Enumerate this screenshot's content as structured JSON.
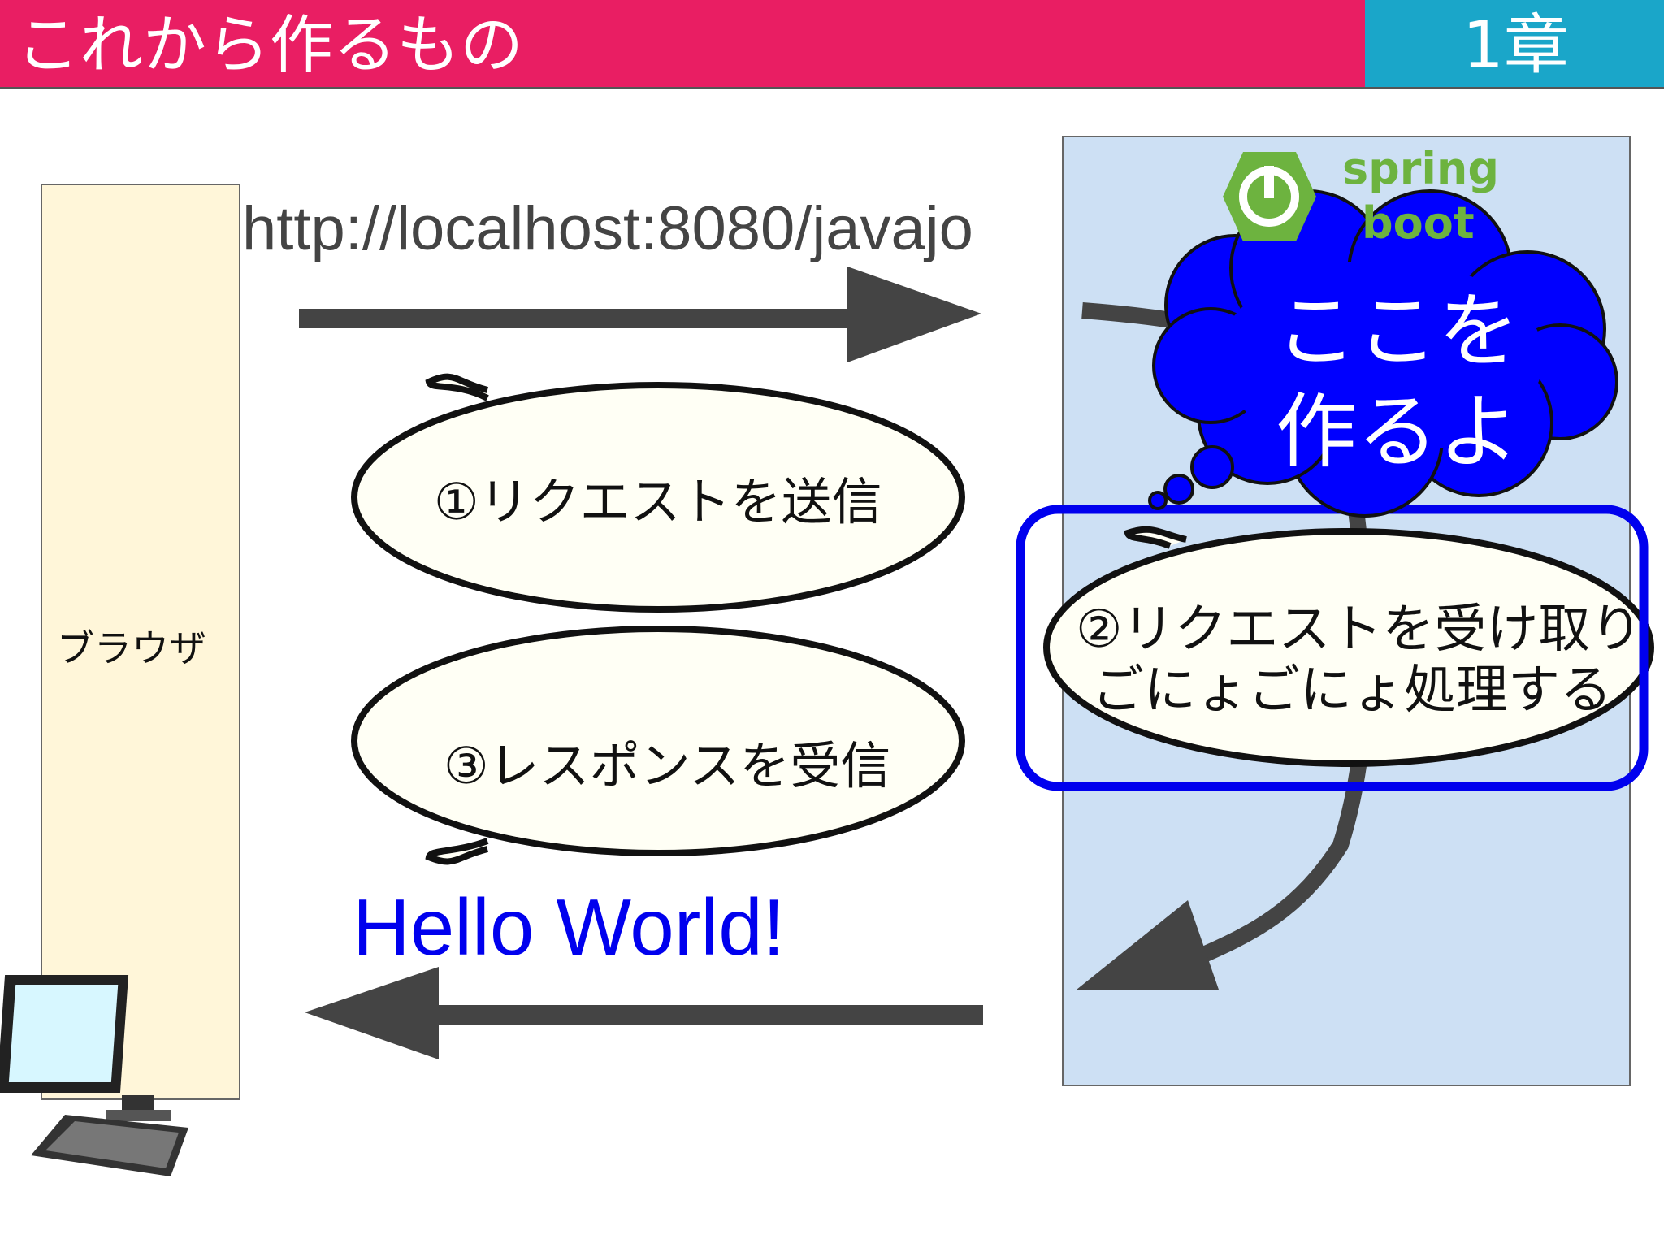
{
  "header": {
    "title": "これから作るもの",
    "chapter": "1章"
  },
  "browser": {
    "label": "ブラウザ"
  },
  "request": {
    "url": "http://localhost:8080/javajo",
    "step1": "①リクエストを送信"
  },
  "response": {
    "hello": "Hello World!",
    "step3": "③レスポンスを受信"
  },
  "server": {
    "logo_line1": "spring",
    "logo_line2": "boot",
    "cloud_line1": "ここを",
    "cloud_line2": "作るよ",
    "step2_line1": "②リクエストを受け取り",
    "step2_line2": "ごにょごにょ処理する"
  },
  "colors": {
    "title_bar": "#e91e63",
    "chapter_bar": "#1aa6c9",
    "cloud": "#0000ff",
    "spring_green": "#6db33f",
    "hello": "#0000ee"
  },
  "icons": [
    "computer-icon",
    "spring-power-icon"
  ]
}
